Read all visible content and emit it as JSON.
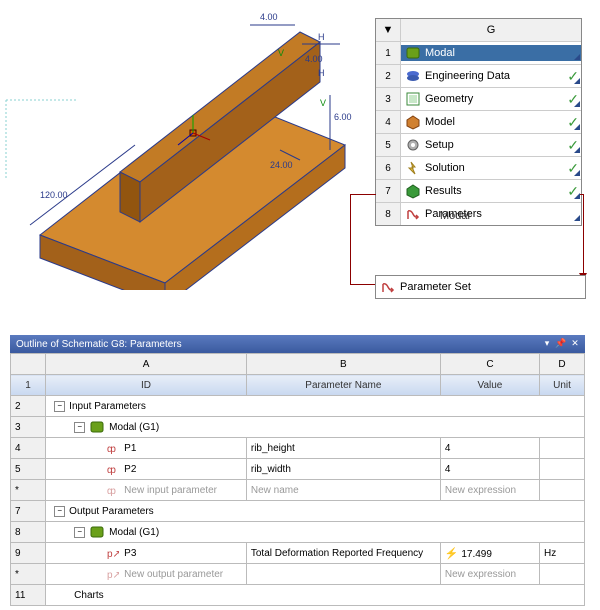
{
  "model_dimensions": {
    "length": "120.00",
    "width": "24.00",
    "height": "6.00",
    "rib_h1": "4.00",
    "rib_h2": "4.00"
  },
  "system": {
    "column": "G",
    "header_arrow": "▼",
    "rows": [
      {
        "num": "1",
        "label": "Modal",
        "icon": "modal-icon",
        "check": true,
        "selected": true
      },
      {
        "num": "2",
        "label": "Engineering Data",
        "icon": "engdata-icon",
        "check": true
      },
      {
        "num": "3",
        "label": "Geometry",
        "icon": "geometry-icon",
        "check": true
      },
      {
        "num": "4",
        "label": "Model",
        "icon": "model-icon",
        "check": true
      },
      {
        "num": "5",
        "label": "Setup",
        "icon": "setup-icon",
        "check": true
      },
      {
        "num": "6",
        "label": "Solution",
        "icon": "solution-icon",
        "check": true
      },
      {
        "num": "7",
        "label": "Results",
        "icon": "results-icon",
        "check": true
      },
      {
        "num": "8",
        "label": "Parameters",
        "icon": "parameters-icon",
        "check": false
      }
    ],
    "bottom_label": "Modal"
  },
  "parameter_set": {
    "label": "Parameter Set"
  },
  "outline": {
    "title": "Outline of Schematic G8: Parameters",
    "columns": {
      "A": "A",
      "B": "B",
      "C": "C",
      "D": "D"
    },
    "subheaders": {
      "A": "ID",
      "B": "Parameter Name",
      "C": "Value",
      "D": "Unit"
    },
    "rows": [
      {
        "num": "2",
        "a": "Input Parameters",
        "type": "group0"
      },
      {
        "num": "3",
        "a": "Modal (G1)",
        "type": "group1"
      },
      {
        "num": "4",
        "a": "P1",
        "b": "rib_height",
        "c": "4",
        "d": "",
        "type": "param-in"
      },
      {
        "num": "5",
        "a": "P2",
        "b": "rib_width",
        "c": "4",
        "d": "",
        "type": "param-in"
      },
      {
        "num": "*",
        "a": "New input parameter",
        "b": "New name",
        "c": "New expression",
        "d": "",
        "type": "new-in"
      },
      {
        "num": "7",
        "a": "Output Parameters",
        "type": "group0"
      },
      {
        "num": "8",
        "a": "Modal (G1)",
        "type": "group1"
      },
      {
        "num": "9",
        "a": "P3",
        "b": "Total Deformation Reported Frequency",
        "c": "17.499",
        "d": "Hz",
        "type": "param-out",
        "lightning": true
      },
      {
        "num": "*",
        "a": "New output parameter",
        "b": "",
        "c": "New expression",
        "d": "",
        "type": "new-out"
      },
      {
        "num": "11",
        "a": "Charts",
        "type": "plain"
      }
    ]
  }
}
